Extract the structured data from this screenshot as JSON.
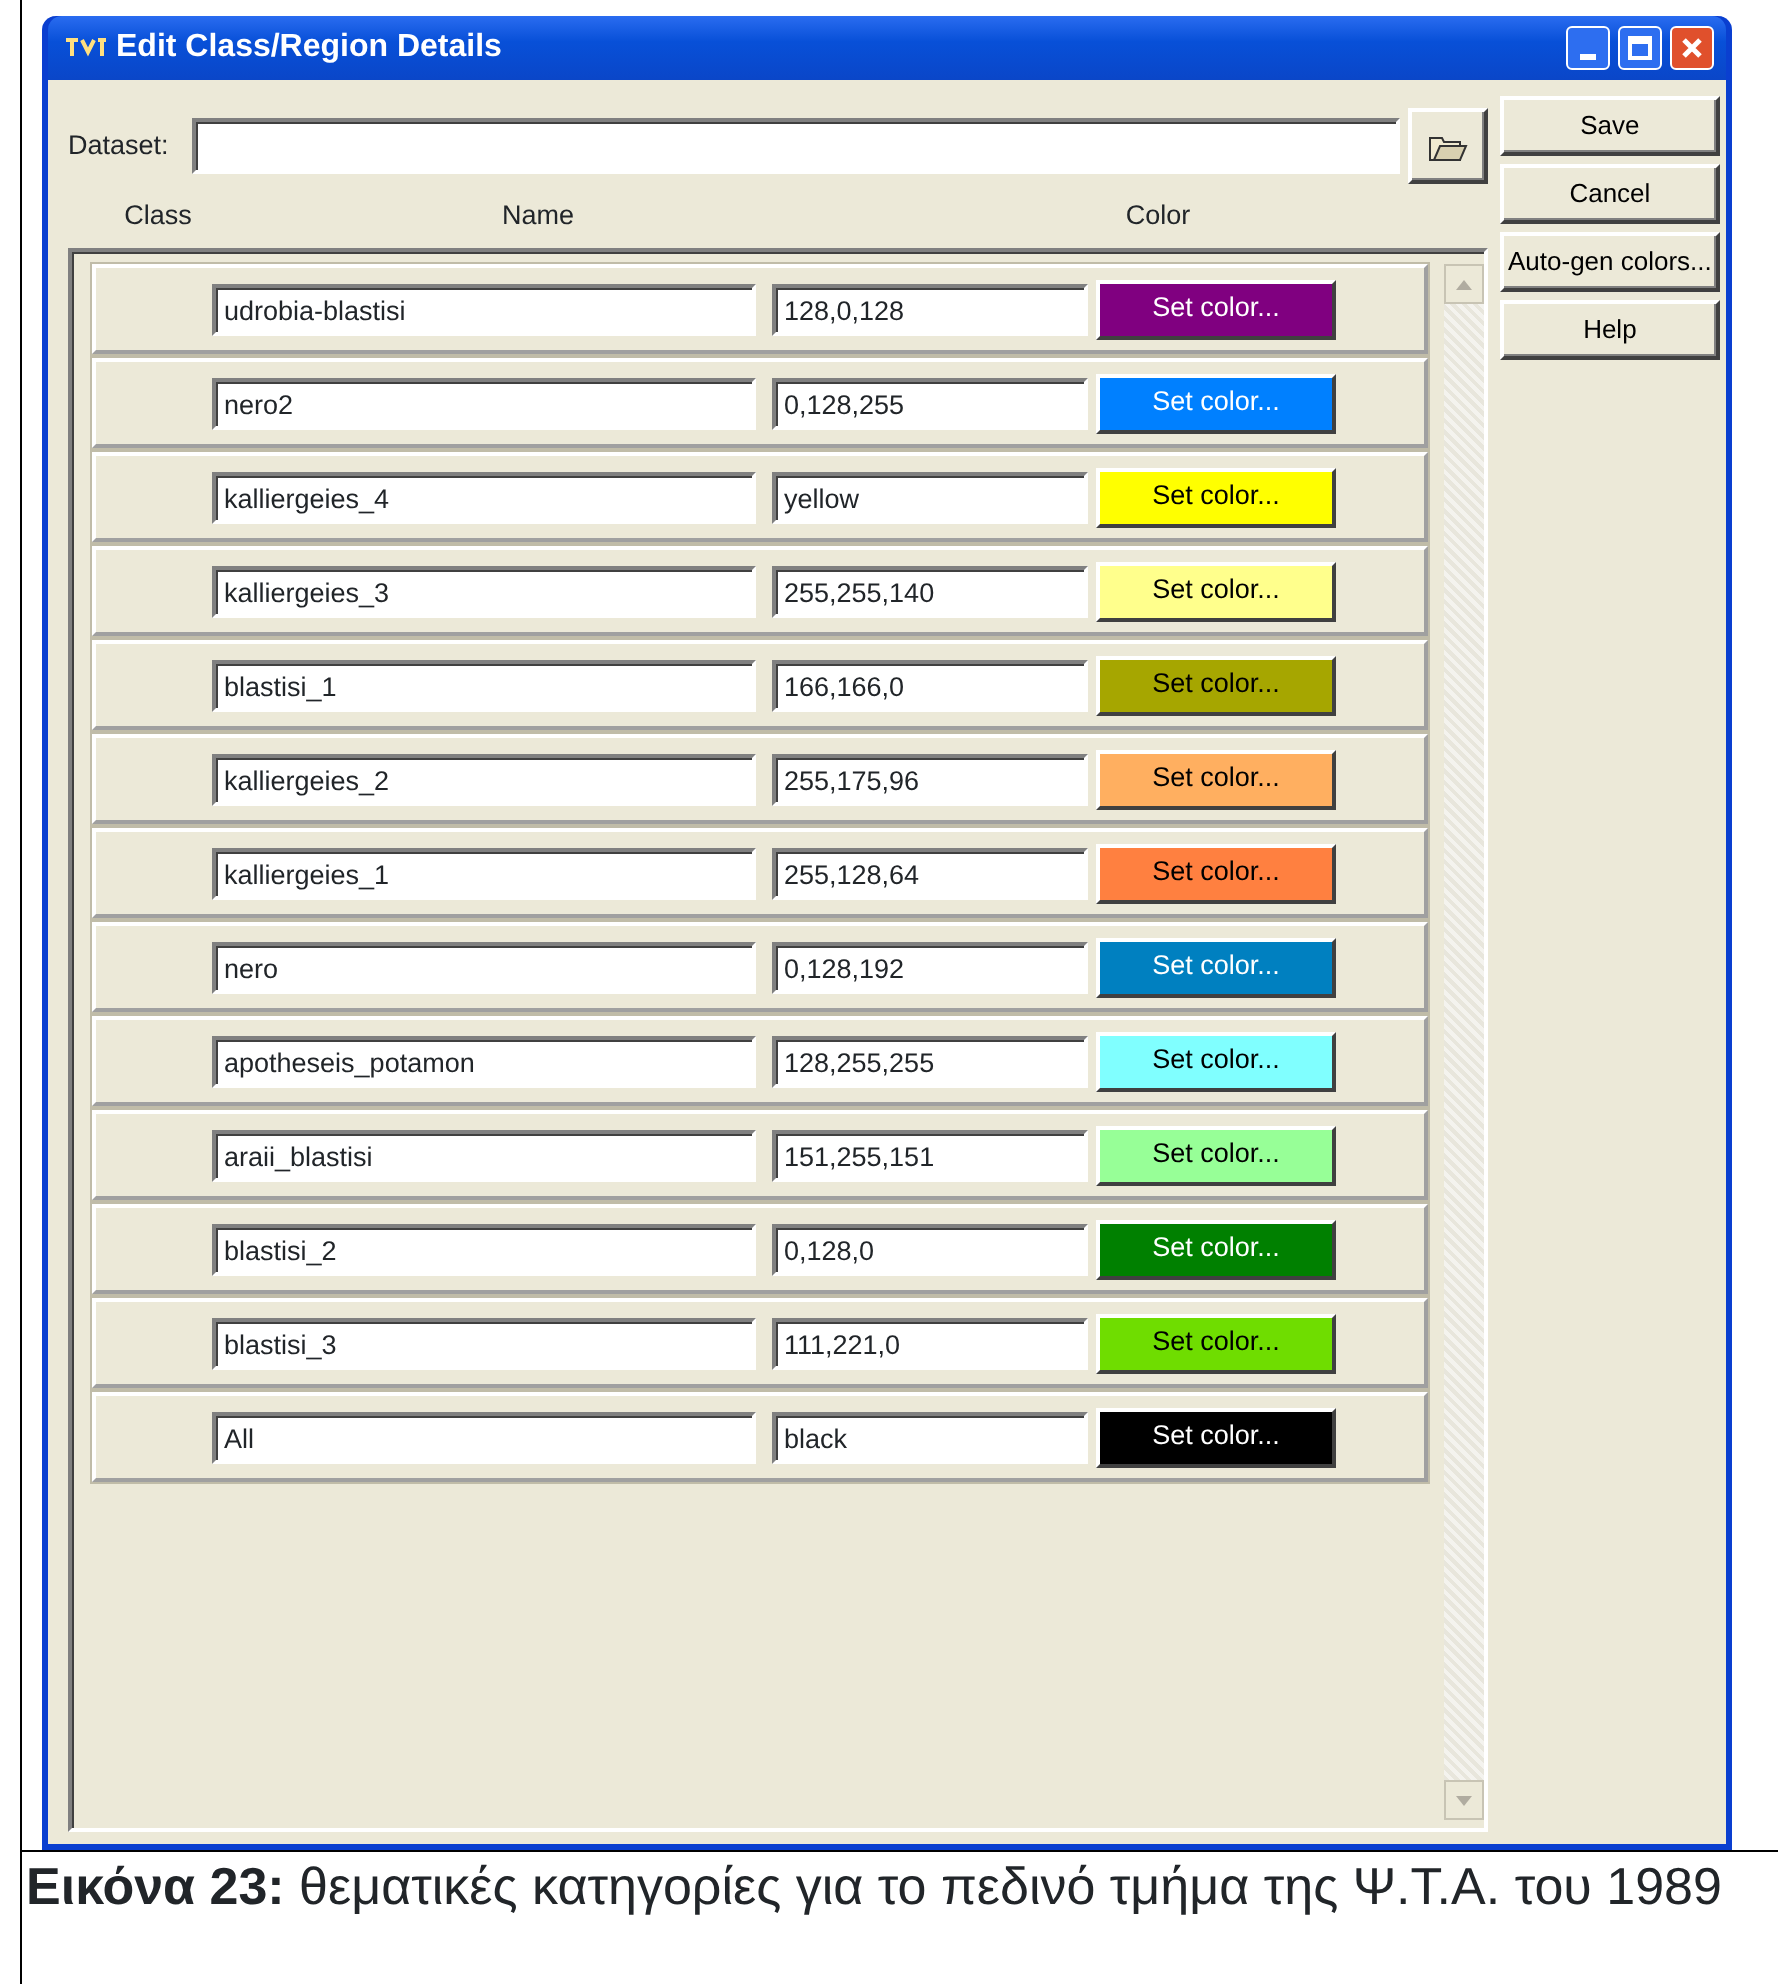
{
  "window": {
    "title": "Edit Class/Region Details"
  },
  "dataset": {
    "label": "Dataset:"
  },
  "columns": [
    "Class",
    "Name",
    "Color"
  ],
  "rows": [
    {
      "name": "udrobia-blastisi",
      "value": "128,0,128",
      "button": "Set color...",
      "color": "#800080"
    },
    {
      "name": "nero2",
      "value": "0,128,255",
      "button": "Set color...",
      "color": "#0080ff"
    },
    {
      "name": "kalliergeies_4",
      "value": "yellow",
      "button": "Set color...",
      "color": "#ffff00"
    },
    {
      "name": "kalliergeies_3",
      "value": "255,255,140",
      "button": "Set color...",
      "color": "#ffff8c"
    },
    {
      "name": "blastisi_1",
      "value": "166,166,0",
      "button": "Set color...",
      "color": "#a6a600"
    },
    {
      "name": "kalliergeies_2",
      "value": "255,175,96",
      "button": "Set color...",
      "color": "#ffaf60"
    },
    {
      "name": "kalliergeies_1",
      "value": "255,128,64",
      "button": "Set color...",
      "color": "#ff8040"
    },
    {
      "name": "nero",
      "value": "0,128,192",
      "button": "Set color...",
      "color": "#0080c0"
    },
    {
      "name": "apotheseis_potamon",
      "value": "128,255,255",
      "button": "Set color...",
      "color": "#80ffff"
    },
    {
      "name": "araii_blastisi",
      "value": "151,255,151",
      "button": "Set color...",
      "color": "#97ff97"
    },
    {
      "name": "blastisi_2",
      "value": "0,128,0",
      "button": "Set color...",
      "color": "#008000"
    },
    {
      "name": "blastisi_3",
      "value": "111,221,0",
      "button": "Set color...",
      "color": "#6fdd00"
    },
    {
      "name": "All",
      "value": "black",
      "button": "Set color...",
      "color": "#000000"
    }
  ],
  "buttons": [
    {
      "label": "Save"
    },
    {
      "label": "Cancel"
    },
    {
      "label": "Auto-gen colors..."
    },
    {
      "label": "Help"
    }
  ],
  "caption": "**Εικόνα 23:**  θεματικές κατηγορίες για το πεδινό τμήμα της Ψ.Τ.Α. του 1989"
}
